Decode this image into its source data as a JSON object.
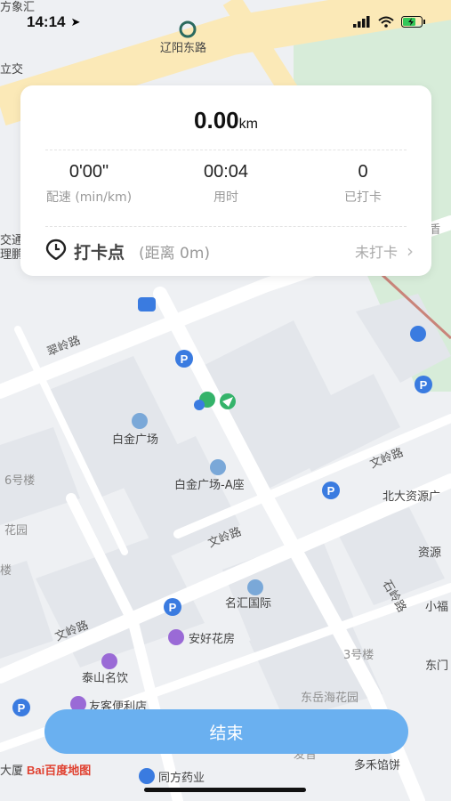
{
  "status_bar": {
    "time": "14:14"
  },
  "tracker": {
    "distance_value": "0.00",
    "distance_unit": "km",
    "stats": [
      {
        "value": "0'00\"",
        "label": "配速 (min/km)"
      },
      {
        "value": "00:04",
        "label": "用时"
      },
      {
        "value": "0",
        "label": "已打卡"
      }
    ],
    "checkin_title": "打卡点",
    "checkin_distance": "(距离 0m)",
    "checkin_status": "未打卡"
  },
  "end_button_label": "结束",
  "map": {
    "labels": [
      "辽阳东路",
      "立交",
      "方象汇",
      "交通",
      "理鹏",
      "翠岭路",
      "白金广场",
      "白金广场-A座",
      "6号楼",
      "花园",
      "楼",
      "文岭路",
      "文岭路",
      "文岭路",
      "北大资源广",
      "资源",
      "名汇国际",
      "安好花房",
      "石岭路",
      "小福",
      "3号楼",
      "东门",
      "泰山名饮",
      "东岳海花园",
      "友客便利店",
      "大厦",
      "同方药业",
      "多禾馅饼",
      "盾",
      "发音"
    ],
    "brand": "Bai百度地图"
  },
  "colors": {
    "accent": "#6ab0f0",
    "park": "#d7ecd9",
    "road_major": "#fbe9b7"
  }
}
